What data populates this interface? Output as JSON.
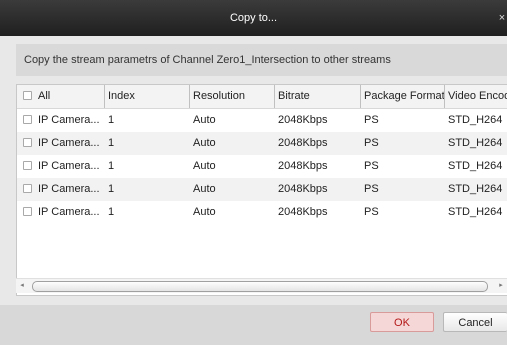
{
  "dialog": {
    "title": "Copy to...",
    "close_glyph": "×",
    "description": "Copy the stream parametrs of Channel Zero1_Intersection to other streams"
  },
  "table": {
    "columns": [
      "All",
      "Index",
      "Resolution",
      "Bitrate",
      "Package Format",
      "Video Encod"
    ],
    "rows": [
      {
        "name": "IP Camera...",
        "index": "1",
        "resolution": "Auto",
        "bitrate": "2048Kbps",
        "package_format": "PS",
        "video_encoding": "STD_H264"
      },
      {
        "name": "IP Camera...",
        "index": "1",
        "resolution": "Auto",
        "bitrate": "2048Kbps",
        "package_format": "PS",
        "video_encoding": "STD_H264"
      },
      {
        "name": "IP Camera...",
        "index": "1",
        "resolution": "Auto",
        "bitrate": "2048Kbps",
        "package_format": "PS",
        "video_encoding": "STD_H264"
      },
      {
        "name": "IP Camera...",
        "index": "1",
        "resolution": "Auto",
        "bitrate": "2048Kbps",
        "package_format": "PS",
        "video_encoding": "STD_H264"
      },
      {
        "name": "IP Camera...",
        "index": "1",
        "resolution": "Auto",
        "bitrate": "2048Kbps",
        "package_format": "PS",
        "video_encoding": "STD_H264"
      }
    ]
  },
  "scrollbar": {
    "left_arrow": "◂",
    "right_arrow": "▸"
  },
  "buttons": {
    "ok": "OK",
    "cancel": "Cancel"
  },
  "colors": {
    "titlebar": "#2a2a2a",
    "ok_text": "#b31818",
    "ok_bg": "#f6d7d7"
  }
}
